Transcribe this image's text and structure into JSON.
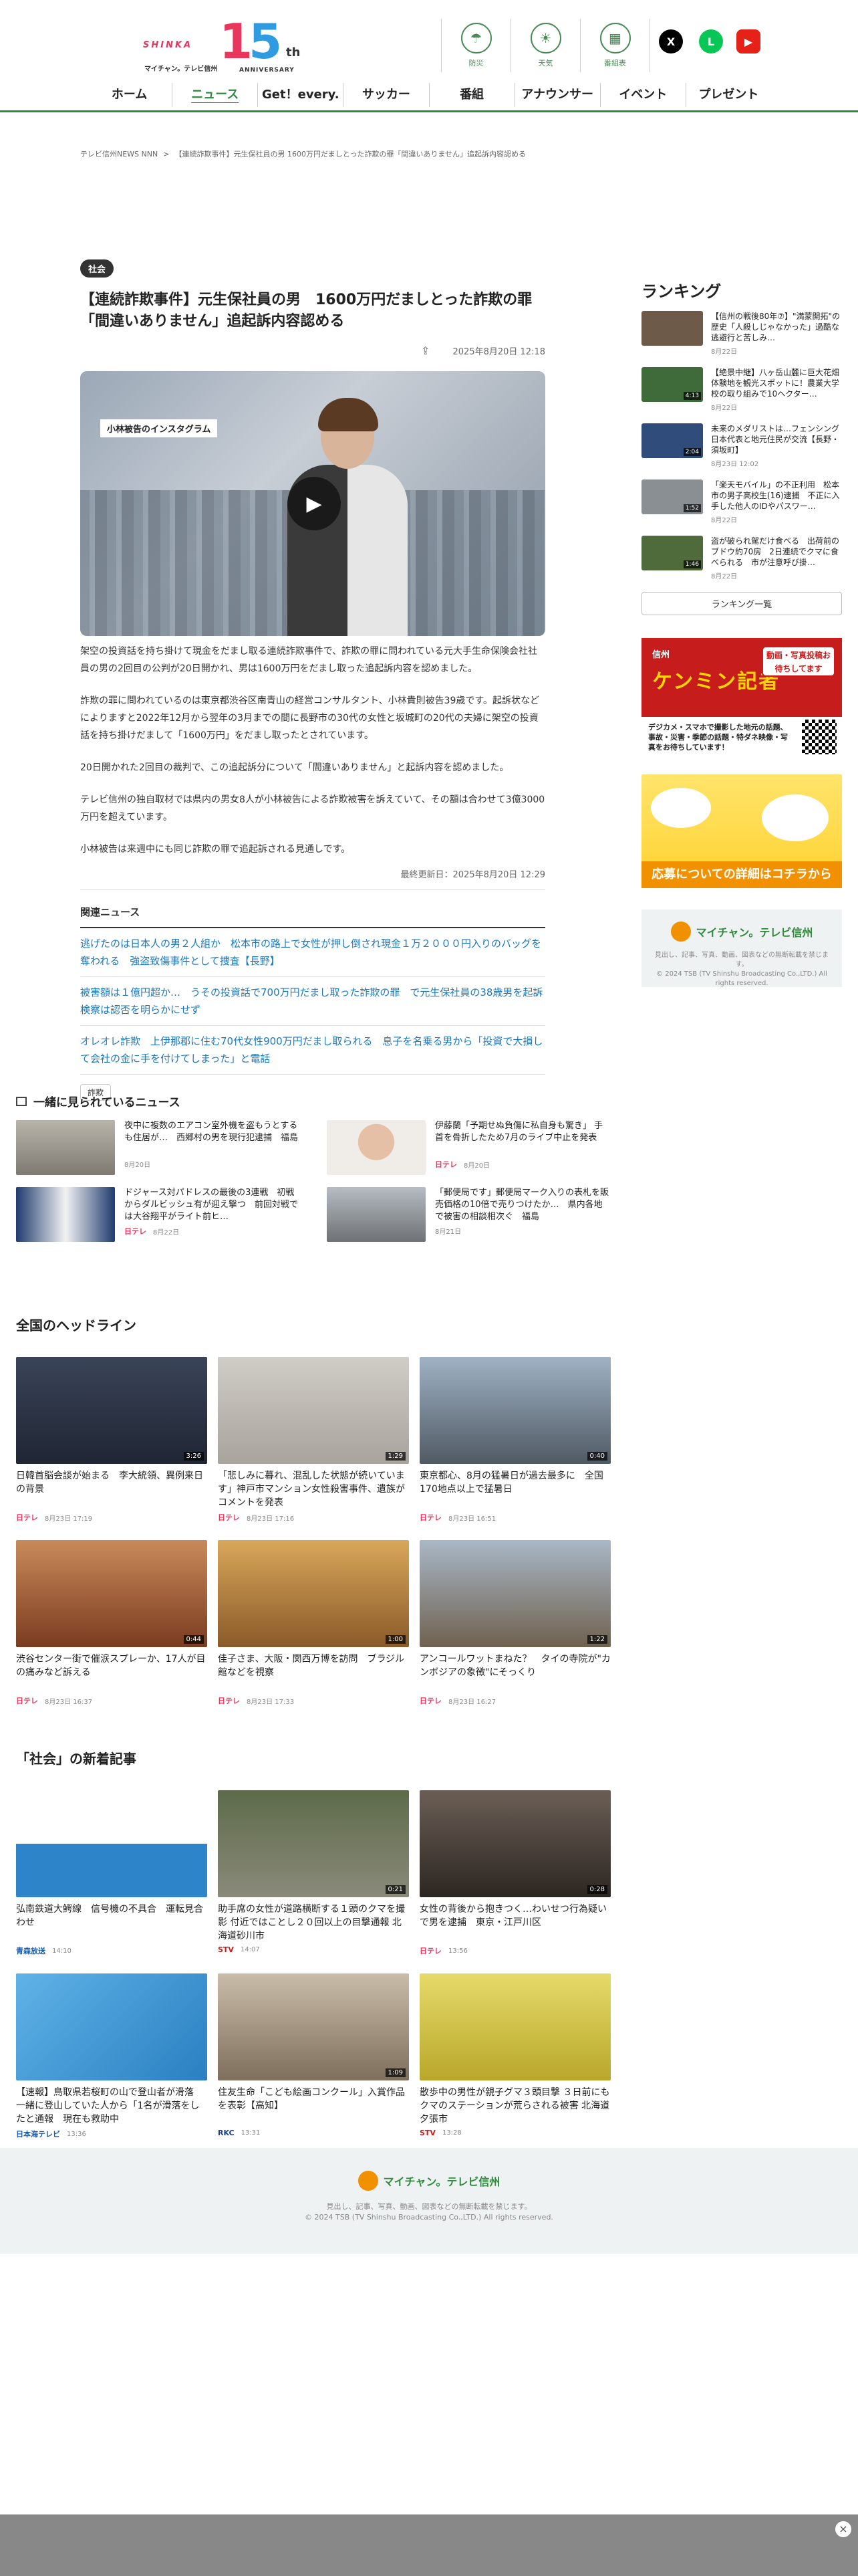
{
  "header": {
    "logo": {
      "shinka": "SHINKA",
      "digit1": "1",
      "digit2": "5",
      "th": "th",
      "sub": "マイチャン。テレビ信州",
      "anniversary": "ANNIVERSARY"
    },
    "icons": [
      {
        "label": "防災",
        "icon": "umbrella-icon",
        "glyph": "☂"
      },
      {
        "label": "天気",
        "icon": "sun-icon",
        "glyph": "☀"
      },
      {
        "label": "番組表",
        "icon": "tv-schedule-icon",
        "glyph": "▦"
      }
    ],
    "social": [
      {
        "icon": "x-icon",
        "glyph": "X",
        "color": "#000000"
      },
      {
        "icon": "line-icon",
        "glyph": "L",
        "color": "#06c755"
      },
      {
        "icon": "youtube-icon",
        "glyph": "▶",
        "color": "#e62117"
      }
    ],
    "nav": [
      "ホーム",
      "ニュース",
      "Get！every.",
      "サッカー",
      "番組",
      "アナウンサー",
      "イベント",
      "プレゼント"
    ],
    "nav_active": "ニュース",
    "accent": "#2f8a3b"
  },
  "breadcrumb": {
    "home": "テレビ信州NEWS NNN",
    "sep": ">",
    "current": "【連続詐欺事件】元生保社員の男 1600万円だましとった詐欺の罪「間違いありません」追起訴内容認める"
  },
  "article": {
    "category": "社会",
    "title": "【連続詐欺事件】元生保社員の男　1600万円だましとった詐欺の罪「間違いありません」追起訴内容認める",
    "date": "2025年8月20日 12:18",
    "share_icon": "share-icon",
    "image_caption": "小林被告のインスタグラム",
    "paragraphs": [
      "架空の投資話を持ち掛けて現金をだまし取る連続詐欺事件で、詐欺の罪に問われている元大手生命保険会社社員の男の2回目の公判が20日開かれ、男は1600万円をだまし取った追起訴内容を認めました。",
      "詐欺の罪に問われているのは東京都渋谷区南青山の経営コンサルタント、小林貴則被告39歳です。起訴状などによりますと2022年12月から翌年の3月までの間に長野市の30代の女性と坂城町の20代の夫婦に架空の投資話を持ち掛けだまして「1600万円」をだまし取ったとされています。",
      "20日開かれた2回目の裁判で、この追起訴分について「間違いありません」と起訴内容を認めました。",
      "テレビ信州の独自取材では県内の男女8人が小林被告による詐欺被害を訴えていて、その額は合わせて3億3000万円を超えています。",
      "小林被告は来週中にも同じ詐欺の罪で追起訴される見通しです。"
    ],
    "updated": "最終更新日：2025年8月20日 12:29",
    "related_heading": "関連ニュース",
    "related": [
      "逃げたのは日本人の男２人組か　松本市の路上で女性が押し倒され現金１万２０００円入りのバッグを奪われる　強盗致傷事件として捜査【長野】",
      "被害額は１億円超か…　うその投資話で700万円だまし取った詐欺の罪　で元生保社員の38歳男を起訴　検察は認否を明らかにせず",
      "オレオレ詐欺　上伊那郡に住む70代女性900万円だまし取られる　息子を名乗る男から「投資で大損して会社の金に手を付けてしまった」と電話"
    ],
    "tag": "詐欺"
  },
  "ranking": {
    "heading": "ランキング",
    "items": [
      {
        "title": "【信州の戦後80年⑦】\"満蒙開拓\"の歴史「人殺しじゃなかった」過酷な逃避行と苦しみ…",
        "date": "8月22日",
        "duration": "",
        "color": "#6d5a48"
      },
      {
        "title": "【絶景中継】八ヶ岳山麓に巨大花畑　体験地を観光スポットに！農業大学校の取り組みで10ヘクター…",
        "date": "8月22日",
        "duration": "4:13",
        "color": "#3f6b3a"
      },
      {
        "title": "未来のメダリストは…フェンシング日本代表と地元住民が交流【長野・須坂町】",
        "date": "8月23日 12:02",
        "duration": "2:04",
        "color": "#2f4c7a"
      },
      {
        "title": "「楽天モバイル」の不正利用　松本市の男子高校生(16)逮捕　不正に入手した他人のIDやパスワー…",
        "date": "8月22日",
        "duration": "1:52",
        "color": "#8a8f94"
      },
      {
        "title": "盗が破られ駕だけ食べる　出荷前のブドウ約70房　2日連続でクマに食べられる　市が注意呼び掛…",
        "date": "8月22日",
        "duration": "1:46",
        "color": "#4f6a3b"
      }
    ],
    "more": "ランキング一覧"
  },
  "banners": {
    "kenmin": {
      "small": "信州",
      "big": "ケンミン記者",
      "callout": "動画・写真投稿お待ちしてます",
      "foot": "デジカメ・スマホで撮影した地元の話題、事故・災害・季節の話題・特ダネ映像・写真をお待ちしています！"
    },
    "apply": {
      "foot": "応募についての詳細はコチラから"
    }
  },
  "brand": {
    "name": "マイチャン。テレビ信州",
    "copyright_a": "見出し、記事、写真、動画、図表などの無断転載を禁じます。",
    "copyright_b": "© 2024 TSB (TV Shinshu Broadcasting Co.,LTD.) All rights reserved."
  },
  "seen": {
    "heading": "一緒に見られているニュース",
    "items": [
      {
        "title": "夜中に複数のエアコン室外機を盗もうとするも住居が…　西郷村の男を現行犯逮捕　福島",
        "source": "",
        "date": "8月20日",
        "color": "#8c8a84"
      },
      {
        "title": "伊藤蘭「予期せぬ負傷に私自身も驚き」 手首を骨折したため7月のライブ中止を発表",
        "source": "日テレ",
        "date": "8月20日",
        "color": "#d9a78a"
      },
      {
        "title": "ドジャース対パドレスの最後の3連戦　初戦からダルビッシュ有が迎え撃つ　前回対戦では大谷翔平がライト前ヒ…",
        "source": "日テレ",
        "date": "8月22日",
        "color": "#1f3b6e"
      },
      {
        "title": "「郵便局です」郵便局マーク入りの表札を販売価格の10倍で売りつけたか…　県内各地で被害の相談相次ぐ　福島",
        "source": "",
        "date": "8月21日",
        "color": "#7a7d80"
      }
    ]
  },
  "national": {
    "heading": "全国のヘッドライン",
    "items": [
      {
        "title": "日韓首脳会談が始まる　李大統領、異例来日の背景",
        "source": "日テレ",
        "date": "8月23日 17:19",
        "duration": "3:26",
        "color": "#2a3242"
      },
      {
        "title": "「悲しみに暮れ、混乱した状態が続いています」神戸市マンション女性殺害事件、遺族がコメントを発表",
        "source": "日テレ",
        "date": "8月23日 17:16",
        "duration": "1:29",
        "color": "#b9b4ae"
      },
      {
        "title": "東京都心、8月の猛暑日が過去最多に　全国170地点以上で猛暑日",
        "source": "日テレ",
        "date": "8月23日 16:51",
        "duration": "0:40",
        "color": "#6b7a8a"
      },
      {
        "title": "渋谷センター街で催涙スプレーか、17人が目の痛みなど訴える",
        "source": "日テレ",
        "date": "8月23日 16:37",
        "duration": "0:44",
        "color": "#c36a3a"
      },
      {
        "title": "佳子さま、大阪・関西万博を訪問　ブラジル館などを視察",
        "source": "日テレ",
        "date": "8月23日 17:33",
        "duration": "1:00",
        "color": "#c28a3c"
      },
      {
        "title": "アンコールワットまねた？　タイの寺院が\"カンボジアの象徴\"にそっくり",
        "source": "日テレ",
        "date": "8月23日 16:27",
        "duration": "1:22",
        "color": "#7f8c9a"
      }
    ]
  },
  "society": {
    "heading": "「社会」の新着記事",
    "items": [
      {
        "title": "弘南鉄道大鰐線　信号機の不具合　運転見合わせ",
        "source": "青森放送",
        "date": "14:10",
        "duration": "",
        "color": "#2e84c9"
      },
      {
        "title": "助手席の女性が道路横断する１頭のクマを撮影 付近ではことし２０回以上の目撃通報 北海道砂川市",
        "source": "STV",
        "date": "14:07",
        "duration": "0:21",
        "color": "#5d6b4a"
      },
      {
        "title": "女性の背後から抱きつく…わいせつ行為疑いで男を逮捕　東京・江戸川区",
        "source": "日テレ",
        "date": "13:56",
        "duration": "0:28",
        "color": "#6b5e55"
      },
      {
        "title": "【速報】鳥取県若桜町の山で登山者が滑落　一緒に登山していた人から「1名が滑落をしたと通報　現在も救助中",
        "source": "日本海テレビ",
        "date": "13:36",
        "duration": "",
        "color": "#3b9ad6"
      },
      {
        "title": "住友生命「こども絵画コンクール」入賞作品を表彰【高知】",
        "source": "RKC",
        "date": "13:31",
        "duration": "1:09",
        "color": "#9a8e7e"
      },
      {
        "title": "散歩中の男性が親子グマ３頭目撃 ３日前にもクマのステーションが荒らされる被害 北海道夕張市",
        "source": "STV",
        "date": "13:28",
        "duration": "",
        "color": "#d6c84a"
      }
    ]
  },
  "sticky": {
    "close_glyph": "×"
  }
}
